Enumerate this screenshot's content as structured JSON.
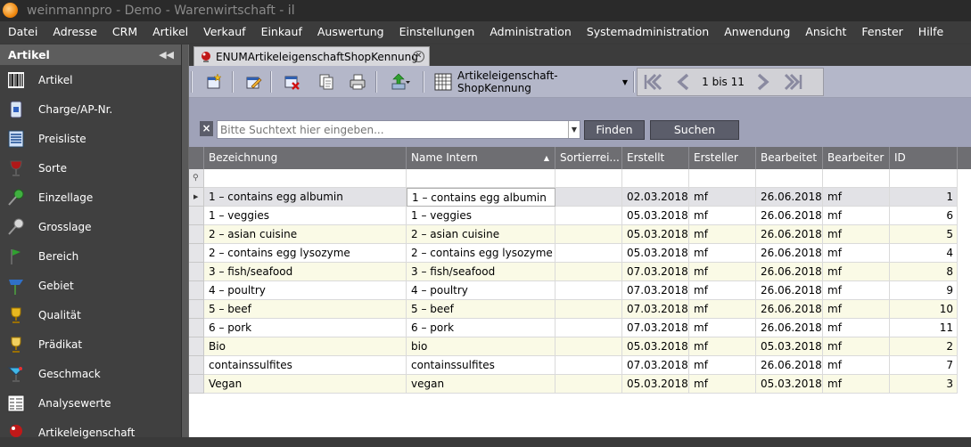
{
  "window": {
    "title": "weinmannpro - Demo - Warenwirtschaft - il"
  },
  "menu": [
    "Datei",
    "Adresse",
    "CRM",
    "Artikel",
    "Verkauf",
    "Einkauf",
    "Auswertung",
    "Einstellungen",
    "Administration",
    "Systemadministration",
    "Anwendung",
    "Ansicht",
    "Fenster",
    "Hilfe"
  ],
  "sidebar": {
    "title": "Artikel",
    "items": [
      {
        "label": "Artikel",
        "icon": "barcode-icon"
      },
      {
        "label": "Charge/AP-Nr.",
        "icon": "bottle-label-icon"
      },
      {
        "label": "Preisliste",
        "icon": "list-document-icon"
      },
      {
        "label": "Sorte",
        "icon": "wine-glass-icon"
      },
      {
        "label": "Einzellage",
        "icon": "pushpin-green-icon"
      },
      {
        "label": "Grosslage",
        "icon": "pushpin-gray-icon"
      },
      {
        "label": "Bereich",
        "icon": "flag-green-icon"
      },
      {
        "label": "Gebiet",
        "icon": "flag-blue-icon"
      },
      {
        "label": "Qualität",
        "icon": "trophy-icon"
      },
      {
        "label": "Prädikat",
        "icon": "trophy-outline-icon"
      },
      {
        "label": "Geschmack",
        "icon": "cocktail-icon"
      },
      {
        "label": "Analysewerte",
        "icon": "analysis-list-icon"
      },
      {
        "label": "Artikeleigenschaft",
        "icon": "wine-property-icon"
      }
    ]
  },
  "tab": {
    "label": "ENUMArtikeleigenschaftShopKennung"
  },
  "toolbar": {
    "view_label": "Artikeleigenschaft-ShopKennung",
    "record_range": "1 bis 11"
  },
  "search": {
    "placeholder": "Bitte Suchtext hier eingeben...",
    "find_label": "Finden",
    "search_label": "Suchen"
  },
  "grid": {
    "columns": [
      "Bezeichnung",
      "Name Intern",
      "Sortierrei...",
      "Erstellt",
      "Ersteller",
      "Bearbeitet",
      "Bearbeiter",
      "ID"
    ],
    "sorted_column": "Name Intern",
    "rows": [
      [
        "1 – contains egg albumin",
        "1 – contains egg albumin",
        "",
        "02.03.2018",
        "mf",
        "26.06.2018",
        "mf",
        "1"
      ],
      [
        "1 – veggies",
        "1 – veggies",
        "",
        "05.03.2018",
        "mf",
        "26.06.2018",
        "mf",
        "6"
      ],
      [
        "2 – asian cuisine",
        "2 – asian cuisine",
        "",
        "05.03.2018",
        "mf",
        "26.06.2018",
        "mf",
        "5"
      ],
      [
        "2 – contains egg lysozyme",
        "2 – contains egg lysozyme",
        "",
        "05.03.2018",
        "mf",
        "26.06.2018",
        "mf",
        "4"
      ],
      [
        "3 – fish/seafood",
        "3 – fish/seafood",
        "",
        "07.03.2018",
        "mf",
        "26.06.2018",
        "mf",
        "8"
      ],
      [
        "4 – poultry",
        "4 – poultry",
        "",
        "07.03.2018",
        "mf",
        "26.06.2018",
        "mf",
        "9"
      ],
      [
        "5 – beef",
        "5 – beef",
        "",
        "07.03.2018",
        "mf",
        "26.06.2018",
        "mf",
        "10"
      ],
      [
        "6 – pork",
        "6 – pork",
        "",
        "07.03.2018",
        "mf",
        "26.06.2018",
        "mf",
        "11"
      ],
      [
        "Bio",
        "bio",
        "",
        "05.03.2018",
        "mf",
        "05.03.2018",
        "mf",
        "2"
      ],
      [
        "containssulfites",
        "containssulfites",
        "",
        "07.03.2018",
        "mf",
        "26.06.2018",
        "mf",
        "7"
      ],
      [
        "Vegan",
        "vegan",
        "",
        "05.03.2018",
        "mf",
        "05.03.2018",
        "mf",
        "3"
      ]
    ]
  },
  "colors": {
    "row_alt": "#fafae6",
    "row_plain": "#ffffff",
    "header_bg": "#6e6e72",
    "toolbar_bg": "#b4b7c9",
    "search_bg": "#9fa2b8"
  }
}
